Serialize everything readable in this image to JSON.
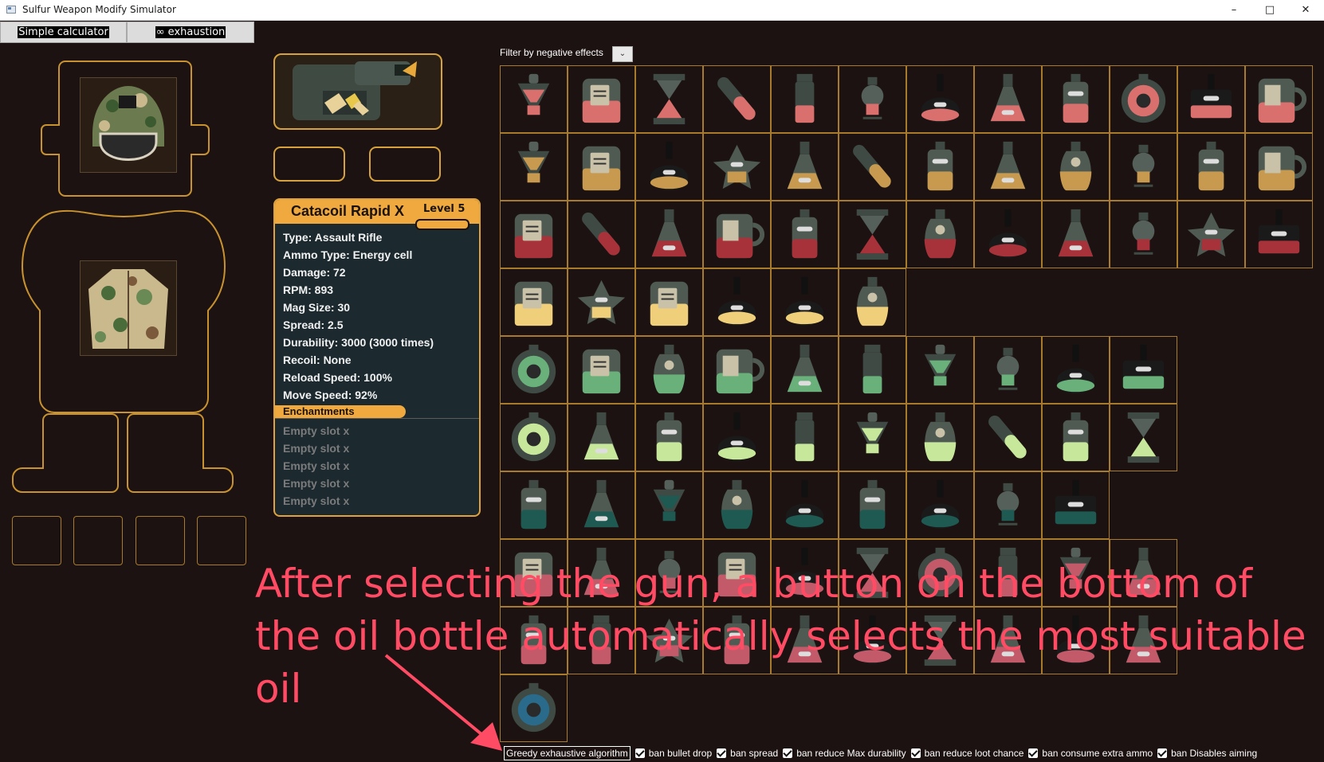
{
  "window": {
    "title": "Sulfur Weapon Modify Simulator",
    "min": "–",
    "max": "□",
    "close": "✕"
  },
  "tabs": [
    "Simple calculator",
    "∞ exhaustion"
  ],
  "weapon": {
    "name": "Catacoil Rapid X",
    "level": "Level 5",
    "stats": [
      "Type:  Assault Rifle",
      "Ammo Type:  Energy cell",
      "Damage:  72",
      "RPM:  893",
      "Mag Size:  30",
      "Spread:  2.5",
      "Durability:  3000  (3000 times)",
      "Recoil:  None",
      "Reload Speed:  100%",
      "Move Speed:  92%"
    ],
    "enchantments_label": "Enchantments",
    "slots": [
      "Empty slot   x",
      "Empty slot   x",
      "Empty slot   x",
      "Empty slot   x",
      "Empty slot   x"
    ]
  },
  "filter": {
    "label": "Filter by negative effects",
    "arrow": "⌄"
  },
  "oil_grid": {
    "rows": [
      {
        "color": "#d9706e",
        "icons": [
          "funnel",
          "jar-label",
          "hourglass",
          "vial",
          "tube",
          "hourglass-small",
          "flask-dark",
          "flask",
          "jar-small",
          "round",
          "cabinet",
          "mug"
        ]
      },
      {
        "color": "#c89a50",
        "icons": [
          "funnel",
          "jar-label",
          "flask-dark",
          "star",
          "flask",
          "vial",
          "jar-small",
          "flask",
          "bottle",
          "hourglass-small",
          "jar-small",
          "mug"
        ]
      },
      {
        "color": "#a8323a",
        "icons": [
          "jar-label",
          "vial",
          "flask",
          "mug",
          "jar-small",
          "hourglass",
          "bottle",
          "flask-dark",
          "flask",
          "hourglass-small",
          "star",
          "cabinet"
        ]
      },
      {
        "color": "#f0cf7a",
        "icons": [
          "jar-label",
          "star",
          "jar-label",
          "flask-dark",
          "flask-dark",
          "bottle"
        ]
      },
      {
        "color": "#6ab07a",
        "icons": [
          "round",
          "jar-label",
          "bottle",
          "mug",
          "flask",
          "tube",
          "funnel",
          "hourglass-small",
          "flask-dark",
          "cabinet"
        ]
      },
      {
        "color": "#c7e89a",
        "icons": [
          "round",
          "flask",
          "jar-small",
          "flask-dark",
          "tube",
          "funnel",
          "bottle",
          "vial",
          "jar-small",
          "hourglass"
        ]
      },
      {
        "color": "#1f5a52",
        "icons": [
          "jar-small",
          "flask",
          "funnel",
          "bottle",
          "flask-dark",
          "jar-small",
          "flask-dark",
          "hourglass-small",
          "cabinet"
        ]
      },
      {
        "color": "#c25a6a",
        "icons": [
          "jar-label",
          "flask",
          "hourglass-small",
          "jar-label",
          "flask-dark",
          "hourglass",
          "round",
          "tube",
          "funnel",
          "flask"
        ]
      },
      {
        "color": "#c25a6a",
        "icons": [
          "jar-small",
          "tube",
          "star",
          "jar-small",
          "flask",
          "flask-dark",
          "hourglass",
          "flask",
          "flask-dark",
          "flask"
        ]
      },
      {
        "color": "#2a6a8a",
        "icons": [
          "round"
        ]
      }
    ]
  },
  "overlay_text": [
    "After selecting the gun, a button on the bottom of",
    "the oil bottle automatically selects the most suitable oil"
  ],
  "bottom": {
    "button": "Greedy exhaustive algorithm",
    "checkboxes": [
      {
        "label": "ban bullet drop",
        "checked": true
      },
      {
        "label": "ban spread",
        "checked": true
      },
      {
        "label": "ban reduce Max durability",
        "checked": true
      },
      {
        "label": "ban reduce loot chance",
        "checked": true
      },
      {
        "label": "ban consume extra ammo",
        "checked": true
      },
      {
        "label": "ban Disables aiming",
        "checked": true
      }
    ]
  },
  "colors": {
    "accent": "#efa93e",
    "panel_bg": "#1c2a30",
    "bg": "#1c1211",
    "overlay": "#ff4b64"
  }
}
